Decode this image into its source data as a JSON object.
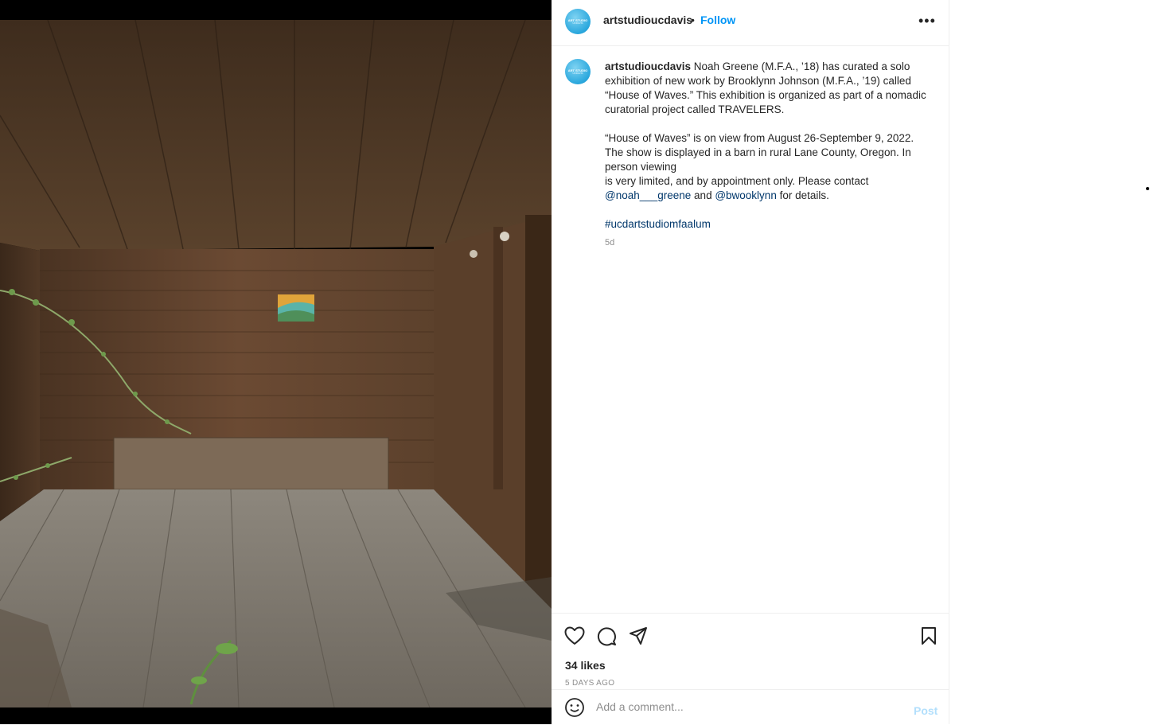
{
  "post": {
    "username": "artstudioucdavis",
    "separator": "•",
    "follow_label": "Follow",
    "more_label": "•••",
    "avatar_line1": "ART STUDIO",
    "avatar_line2": "UCDAVIS"
  },
  "caption": {
    "username": "artstudioucdavis",
    "text1": " Noah Greene (M.F.A., ’18) has curated a solo exhibition of new work by Brooklynn Johnson (M.F.A., ’19) called “House of Waves.” This exhibition is organized as part of a nomadic curatorial project called TRAVELERS.",
    "text2": "“House of Waves” is on view from August 26-September 9, 2022. The show is displayed in a barn in rural Lane County, Oregon. In person viewing",
    "text3": "is very limited, and by appointment only. Please contact",
    "mention1": "@noah___greene",
    "and_text": " and ",
    "mention2": "@bwooklynn",
    "details_text": " for details.",
    "hashtag": "#ucdartstudiomfaalum",
    "time": "5d"
  },
  "actions": {
    "like_icon": "heart-icon",
    "comment_icon": "comment-icon",
    "share_icon": "share-icon",
    "save_icon": "bookmark-icon"
  },
  "stats": {
    "likes": "34 likes",
    "posted": "5 DAYS AGO"
  },
  "comment": {
    "placeholder": "Add a comment...",
    "post_label": "Post",
    "emoji_icon": "smiley-icon"
  },
  "colors": {
    "accent": "#0095f6",
    "link": "#00376b",
    "muted": "#8e8e8e"
  }
}
